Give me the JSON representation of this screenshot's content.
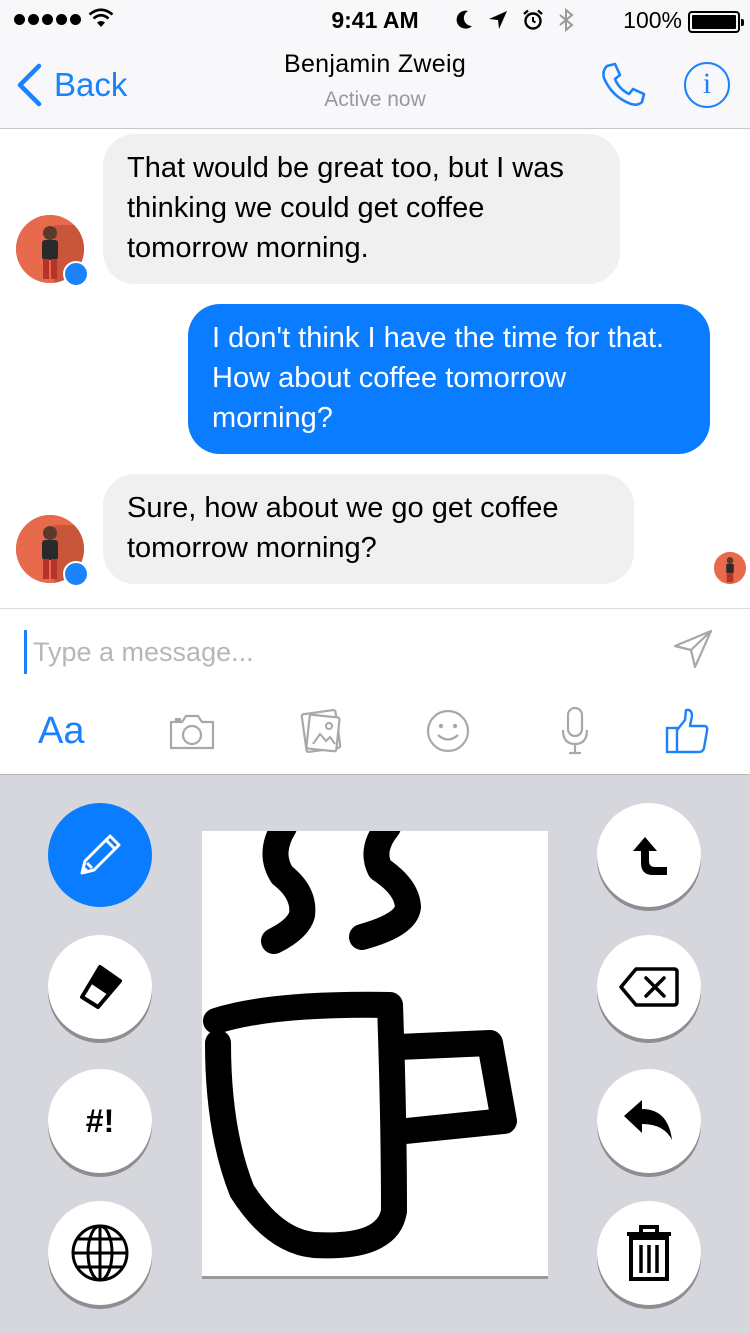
{
  "status_bar": {
    "time": "9:41 AM",
    "battery": "100%"
  },
  "header": {
    "back_label": "Back",
    "contact_name": "Benjamin Zweig",
    "contact_status": "Active now",
    "accent_color": "#1a82fb"
  },
  "messages": [
    {
      "direction": "incoming",
      "text": "That would be great too, but I was thinking we could get coffee tomorrow morning."
    },
    {
      "direction": "outgoing",
      "text": "I don't think I have the time for that. How about coffee tomorrow morning?"
    },
    {
      "direction": "incoming",
      "text": "Sure, how about we go get coffee tomorrow morning?"
    }
  ],
  "composer": {
    "placeholder": "Type a message...",
    "value": "",
    "format_label": "Aa",
    "toolbar_icons": [
      "camera-icon",
      "photo-icon",
      "emoji-icon",
      "microphone-icon",
      "thumbs-up-icon"
    ]
  },
  "doodle": {
    "hashtag_label": "#!",
    "left_tools": [
      "pencil-icon",
      "eraser-icon",
      "hashtag-bang",
      "globe-icon"
    ],
    "right_tools": [
      "shift-icon",
      "backspace-icon",
      "undo-icon",
      "trash-icon"
    ],
    "active_tool": "pencil",
    "drawing": "coffee cup with steam"
  }
}
